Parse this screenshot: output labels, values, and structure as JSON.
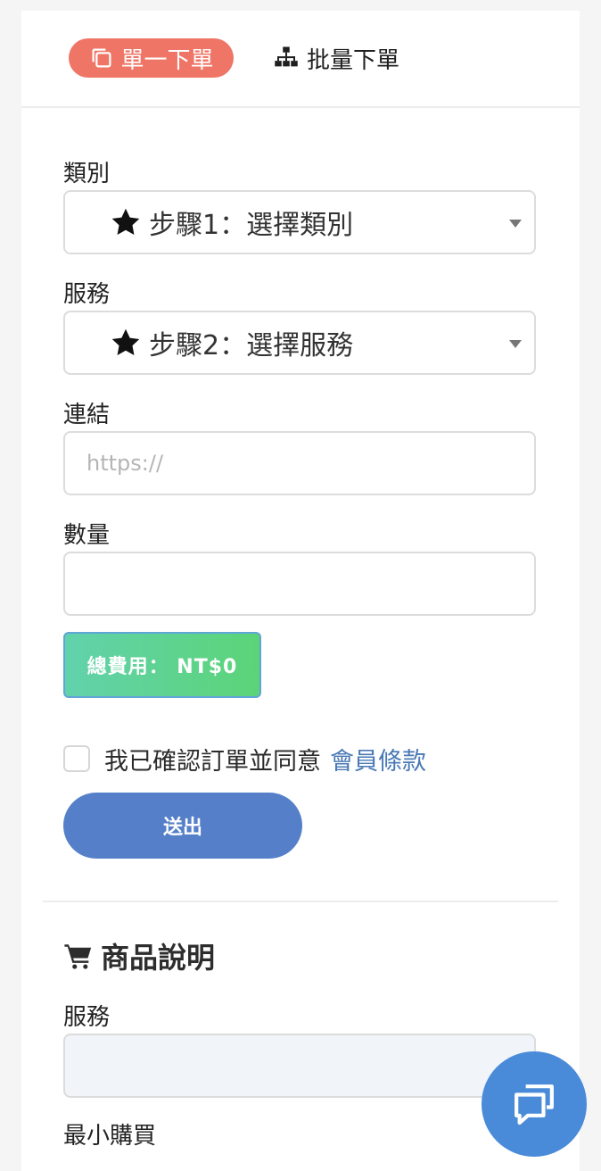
{
  "tabs": {
    "single_label": "單一下單",
    "batch_label": "批量下單"
  },
  "form": {
    "category": {
      "label": "類別",
      "value": "步驟1：選擇類別",
      "icon": "star-icon"
    },
    "service": {
      "label": "服務",
      "value": "步驟2：選擇服務",
      "icon": "star-icon"
    },
    "link": {
      "label": "連結",
      "placeholder": "https://",
      "value": ""
    },
    "quantity": {
      "label": "數量",
      "value": ""
    },
    "total_text": "總費用： NT$0",
    "agree_text": "我已確認訂單並同意",
    "terms_link": "會員條款",
    "submit_label": "送出"
  },
  "description": {
    "title": "商品說明",
    "icon": "cart-icon",
    "service_label": "服務",
    "min_purchase_label": "最小購買"
  },
  "colors": {
    "single_tab": "#ef7566",
    "submit": "#5580c9",
    "total_gradient_start": "#62d2ac",
    "total_gradient_end": "#5bd478",
    "link": "#4a79b4",
    "chat": "#4a8bd9"
  },
  "chat_icon": "chat-icon"
}
